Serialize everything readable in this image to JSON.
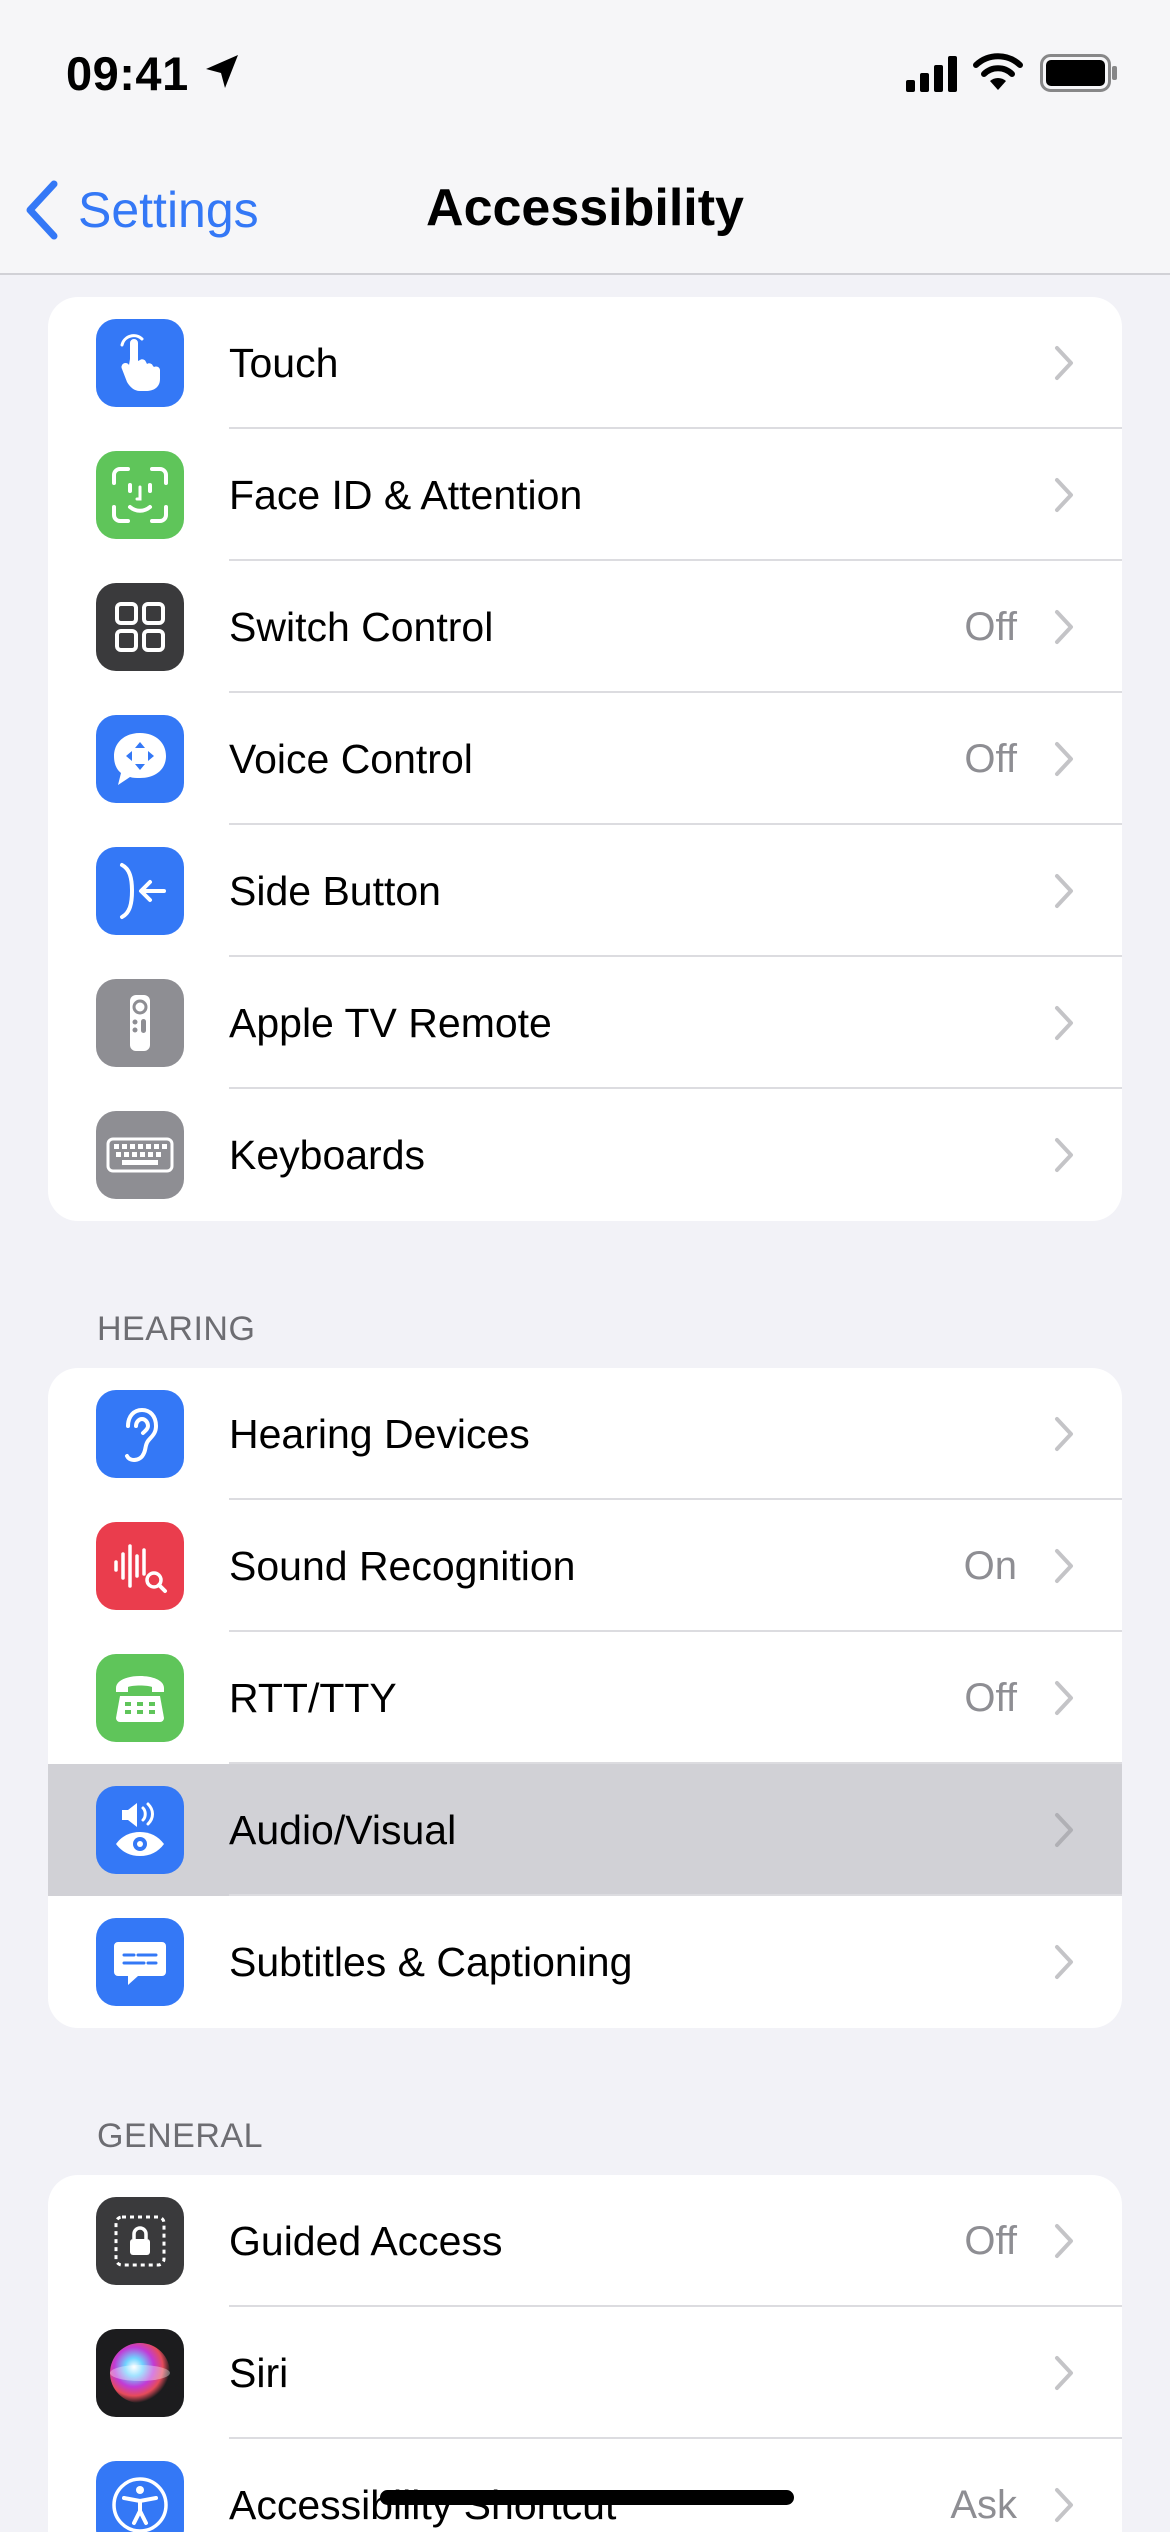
{
  "status_bar": {
    "time": "09:41"
  },
  "nav": {
    "back_label": "Settings",
    "title": "Accessibility"
  },
  "groups": [
    {
      "header": "",
      "items": [
        {
          "label": "Touch",
          "value": "",
          "icon": "hand-pointer-icon",
          "color": "#3478f6"
        },
        {
          "label": "Face ID & Attention",
          "value": "",
          "icon": "face-id-icon",
          "color": "#5fc55a"
        },
        {
          "label": "Switch Control",
          "value": "Off",
          "icon": "grid-squares-icon",
          "color": "#3a3a3c"
        },
        {
          "label": "Voice Control",
          "value": "Off",
          "icon": "voice-control-icon",
          "color": "#3478f6"
        },
        {
          "label": "Side Button",
          "value": "",
          "icon": "side-button-icon",
          "color": "#3478f6"
        },
        {
          "label": "Apple TV Remote",
          "value": "",
          "icon": "tv-remote-icon",
          "color": "#8e8e93"
        },
        {
          "label": "Keyboards",
          "value": "",
          "icon": "keyboard-icon",
          "color": "#8e8e93"
        }
      ]
    },
    {
      "header": "HEARING",
      "items": [
        {
          "label": "Hearing Devices",
          "value": "",
          "icon": "ear-icon",
          "color": "#3478f6"
        },
        {
          "label": "Sound Recognition",
          "value": "On",
          "icon": "sound-recognition-icon",
          "color": "#ea3d4d"
        },
        {
          "label": "RTT/TTY",
          "value": "Off",
          "icon": "tty-phone-icon",
          "color": "#5fc55a"
        },
        {
          "label": "Audio/Visual",
          "value": "",
          "icon": "audio-visual-icon",
          "color": "#3478f6",
          "highlighted": true
        },
        {
          "label": "Subtitles & Captioning",
          "value": "",
          "icon": "captions-icon",
          "color": "#3478f6"
        }
      ]
    },
    {
      "header": "GENERAL",
      "items": [
        {
          "label": "Guided Access",
          "value": "Off",
          "icon": "guided-access-lock-icon",
          "color": "#3a3a3c"
        },
        {
          "label": "Siri",
          "value": "",
          "icon": "siri-icon",
          "color": "#1c1c1e"
        },
        {
          "label": "Accessibility Shortcut",
          "value": "Ask",
          "icon": "accessibility-icon",
          "color": "#3478f6"
        }
      ]
    }
  ]
}
